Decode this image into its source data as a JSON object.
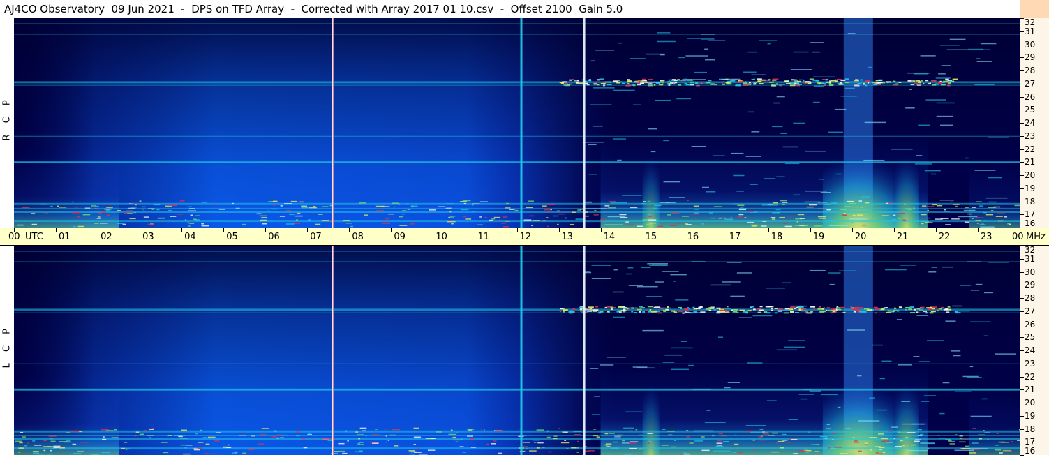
{
  "title": "AJ4CO Observatory  09 Jun 2021  -  DPS on TFD Array  -  Corrected with Array 2017 01 10.csv  -  Offset 2100  Gain 5.0",
  "panels": [
    {
      "name": "rcp",
      "label": "R C P"
    },
    {
      "name": "lcp",
      "label": "L C P"
    }
  ],
  "colors": {
    "background_low": "#00004a",
    "blue_mid": "#0a4fd8",
    "cyan": "#20c8e8",
    "green": "#7de070",
    "yellow": "#f0f060",
    "red": "#e03050",
    "time_axis_bg": "#ffffc8",
    "freq_axis_bg": "#fdf6e8"
  },
  "chart_data": {
    "type": "heatmap",
    "title": "AJ4CO Observatory  09 Jun 2021  -  DPS on TFD Array  -  Corrected with Array 2017 01 10.csv  -  Offset 2100  Gain 5.0",
    "x_axis": {
      "unit_label": "UTC",
      "range": [
        0,
        24
      ],
      "tick_labels": [
        "00",
        "01",
        "02",
        "03",
        "04",
        "05",
        "06",
        "07",
        "08",
        "09",
        "10",
        "11",
        "12",
        "13",
        "14",
        "15",
        "16",
        "17",
        "18",
        "19",
        "20",
        "21",
        "22",
        "23",
        "00"
      ]
    },
    "y_axis": {
      "unit_label": "MHz",
      "range": [
        16,
        32
      ],
      "tick_labels": [
        "32",
        "31",
        "30",
        "29",
        "28",
        "27",
        "26",
        "25",
        "24",
        "23",
        "22",
        "21",
        "20",
        "19",
        "18",
        "17",
        "16"
      ]
    },
    "panels": [
      "R C P",
      "L C P"
    ],
    "vertical_lines_utc": [
      7.6,
      12.1,
      13.6
    ],
    "strong_bands_mhz": [
      16.5,
      17.2,
      17.8,
      21.0,
      27.1
    ],
    "bright_region_utc": [
      19.8,
      20.5
    ]
  }
}
